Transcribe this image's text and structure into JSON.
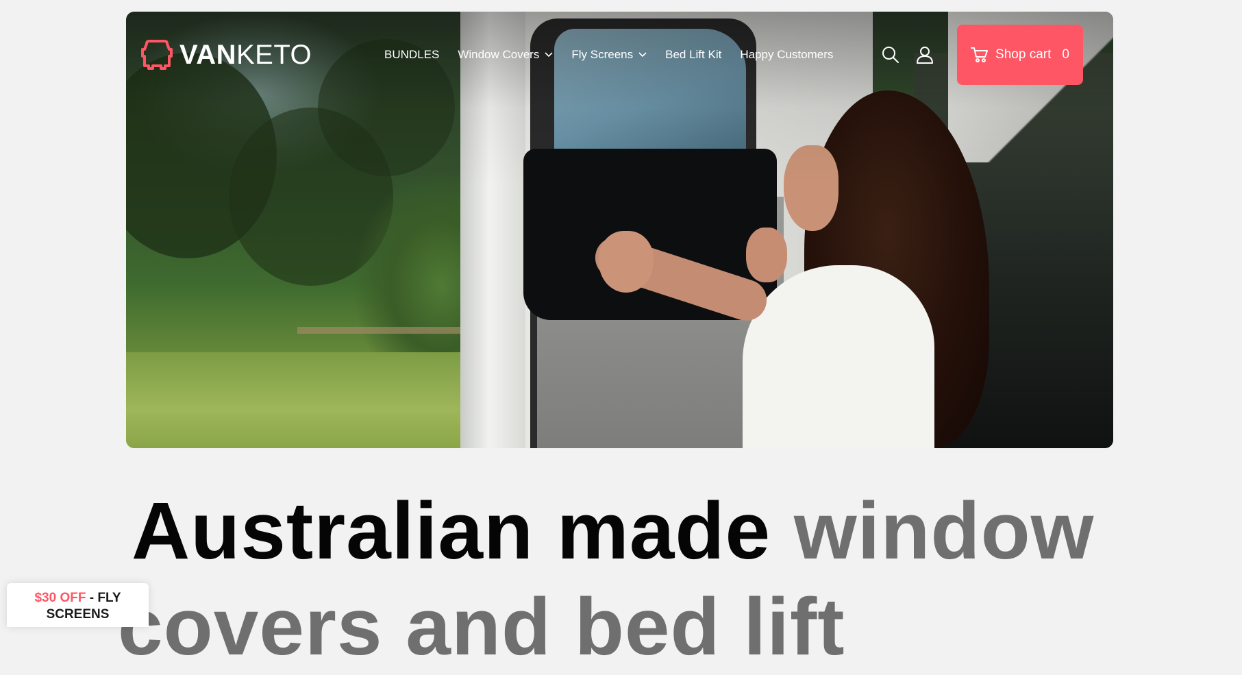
{
  "brand": {
    "name_bold": "VAN",
    "name_light": "KETO",
    "accent_color": "#fe5664"
  },
  "nav": {
    "items": [
      {
        "label": "BUNDLES",
        "has_dropdown": false
      },
      {
        "label": "Window Covers",
        "has_dropdown": true
      },
      {
        "label": "Fly Screens",
        "has_dropdown": true
      },
      {
        "label": "Bed Lift Kit",
        "has_dropdown": false
      },
      {
        "label": "Happy Customers",
        "has_dropdown": false
      }
    ],
    "search_icon": "search-icon",
    "account_icon": "user-icon"
  },
  "cart": {
    "label": "Shop cart",
    "count": "0",
    "icon": "cart-icon"
  },
  "hero": {
    "image_alt": ""
  },
  "headline": {
    "dark_part": "Australian made ",
    "gray_part": "window",
    "line2": "covers and bed lift"
  },
  "promo": {
    "accent_text": "$30 OFF",
    "rest_text": " - FLY SCREENS"
  }
}
